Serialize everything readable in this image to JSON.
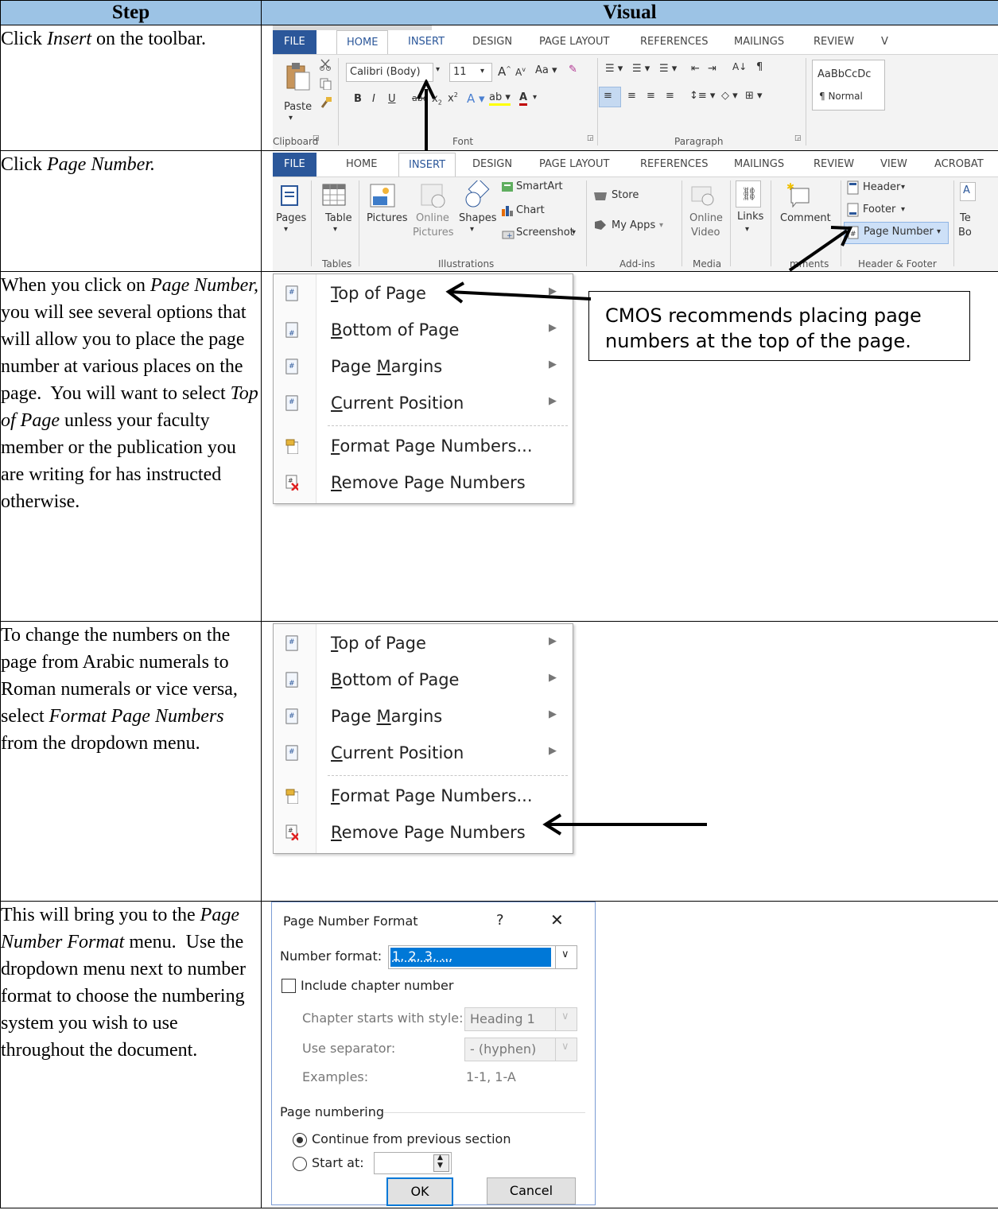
{
  "headers": {
    "step": "Step",
    "visual": "Visual"
  },
  "rows": [
    {
      "step_html": "Click <i>Insert</i> on the toolbar."
    },
    {
      "step_html": "Click <i>Page Number.</i>"
    },
    {
      "step_html": "When you click on <i>Page Number,</i> you will see several options that will allow you to place the page number at various places on the page.&nbsp; You will want to select <i>Top of Page</i> unless your faculty member or the publication you are writing for has instructed otherwise."
    },
    {
      "step_html": "To change the numbers on the page from Arabic numerals to Roman numerals or vice versa, select <i>Format Page Numbers</i> from the dropdown menu."
    },
    {
      "step_html": "This will bring you to the <i>Page Number Format</i> menu.&nbsp; Use the dropdown menu next to number format to choose the numbering system you wish to use throughout the document."
    }
  ],
  "ribbon_home": {
    "tabs": [
      "FILE",
      "HOME",
      "INSERT",
      "DESIGN",
      "PAGE LAYOUT",
      "REFERENCES",
      "MAILINGS",
      "REVIEW",
      "V"
    ],
    "paste": "Paste",
    "font_name": "Calibri (Body)",
    "font_size": "11",
    "style_preview": "AaBbCcDc",
    "style_name": "¶ Normal",
    "groups": {
      "clipboard": "Clipboard",
      "font": "Font",
      "paragraph": "Paragraph"
    }
  },
  "ribbon_insert": {
    "tabs": [
      "FILE",
      "HOME",
      "INSERT",
      "DESIGN",
      "PAGE LAYOUT",
      "REFERENCES",
      "MAILINGS",
      "REVIEW",
      "VIEW",
      "ACROBAT"
    ],
    "buttons": {
      "pages": "Pages",
      "table": "Table",
      "pictures": "Pictures",
      "online_pictures_1": "Online",
      "online_pictures_2": "Pictures",
      "shapes": "Shapes",
      "smartart": "SmartArt",
      "chart": "Chart",
      "screenshot": "Screenshot",
      "store": "Store",
      "my_apps": "My Apps",
      "online_video_1": "Online",
      "online_video_2": "Video",
      "links": "Links",
      "comment": "Comment",
      "header": "Header",
      "footer": "Footer",
      "page_number": "Page Number",
      "text_1": "Te",
      "text_2": "Bo"
    },
    "groups": {
      "tables": "Tables",
      "illustrations": "Illustrations",
      "addins": "Add-ins",
      "media": "Media",
      "comments": "mments",
      "header_footer": "Header & Footer"
    }
  },
  "menu": {
    "items": [
      {
        "pre": "",
        "key": "T",
        "post": "op of Page",
        "submenu": true
      },
      {
        "pre": "",
        "key": "B",
        "post": "ottom of Page",
        "submenu": true
      },
      {
        "pre": "Page ",
        "key": "M",
        "post": "argins",
        "submenu": true
      },
      {
        "pre": "",
        "key": "C",
        "post": "urrent Position",
        "submenu": true
      },
      {
        "pre": "",
        "key": "F",
        "post": "ormat Page Numbers...",
        "submenu": false
      },
      {
        "pre": "",
        "key": "R",
        "post": "emove Page Numbers",
        "submenu": false
      }
    ]
  },
  "callout": "CMOS recommends placing page numbers at the top of the page.",
  "dialog": {
    "title": "Page Number Format",
    "help": "?",
    "close": "✕",
    "number_format_label": "Number format:",
    "number_format_value": "1, 2, 3, ...",
    "include_chapter": "Include chapter number",
    "chapter_style_label": "Chapter starts with style:",
    "chapter_style_value": "Heading 1",
    "separator_label": "Use separator:",
    "separator_value": "-  (hyphen)",
    "examples_label": "Examples:",
    "examples_value": "1-1, 1-A",
    "page_numbering": "Page numbering",
    "continue": "Continue from previous section",
    "start_at": "Start at:",
    "ok": "OK",
    "cancel": "Cancel"
  },
  "colors": {
    "header_bg": "#9cc3e5",
    "word_blue": "#2b579a"
  }
}
